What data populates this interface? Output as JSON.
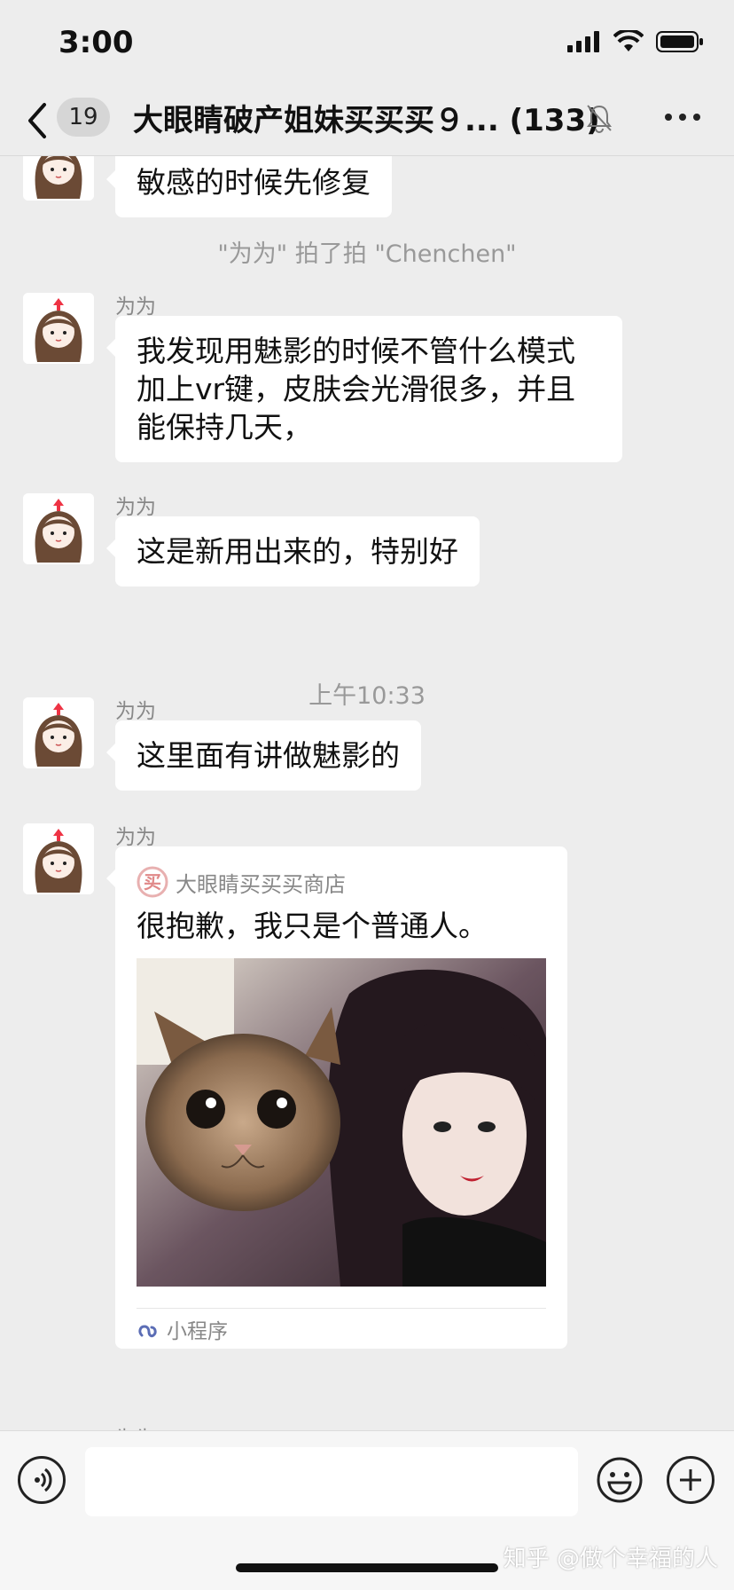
{
  "status_bar": {
    "time": "3:00"
  },
  "nav": {
    "unread_count": "19",
    "title": "大眼睛破产姐妹买买买９... (133)"
  },
  "messages": [
    {
      "sender": "为为",
      "text": "敏感的时候先修复"
    },
    {
      "sender": "为为",
      "text": "我发现用魅影的时候不管什么模式加上vr键，皮肤会光滑很多，并且能保持几天，"
    },
    {
      "sender": "为为",
      "text": "这是新用出来的，特别好"
    },
    {
      "sender": "为为",
      "text": "这里面有讲做魅影的"
    }
  ],
  "system": {
    "pat": "\"为为\" 拍了拍 \"Chenchen\"",
    "time_divider": "上午10:33"
  },
  "card": {
    "sender": "为为",
    "source_icon_char": "买",
    "source": "大眼睛买买买商店",
    "title": "很抱歉，我只是个普通人。",
    "footer": "小程序"
  },
  "partial_sender": "为为",
  "watermark": "知乎 @做个幸福的人",
  "colors": {
    "background": "#ededed",
    "bubble": "#ffffff",
    "accent": "#e8b0b0"
  },
  "icons": [
    "back-icon",
    "mute-bell-icon",
    "more-icon",
    "voice-icon",
    "emoji-icon",
    "plus-icon",
    "mini-program-icon",
    "signal-icon",
    "wifi-icon",
    "battery-icon"
  ]
}
